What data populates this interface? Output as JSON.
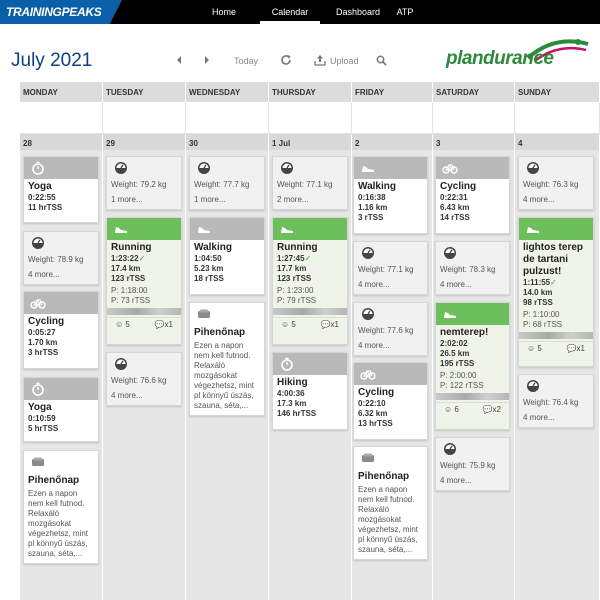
{
  "topbar": {
    "logo": "TRAININGPEAKS",
    "nav": [
      {
        "label": "Home",
        "active": false
      },
      {
        "label": "Calendar",
        "active": true
      },
      {
        "label": "Dashboard",
        "active": false
      },
      {
        "label": "ATP",
        "active": false
      }
    ]
  },
  "toolbar": {
    "month": "July 2021",
    "today": "Today",
    "upload": "Upload",
    "brand": "plandurance"
  },
  "days": [
    "MONDAY",
    "TUESDAY",
    "WEDNESDAY",
    "THURSDAY",
    "FRIDAY",
    "SATURDAY",
    "SUNDAY"
  ],
  "dates": [
    "28",
    "29",
    "30",
    "1 Jul",
    "2",
    "3",
    "4"
  ],
  "cards": {
    "mon_yoga1": {
      "title": "Yoga",
      "duration": "0:22:55",
      "metric": "11 hrTSS"
    },
    "mon_weight": {
      "weight": "Weight: 78.9 kg",
      "more": "4 more..."
    },
    "mon_cycling": {
      "title": "Cycling",
      "duration": "0:05:27",
      "distance": "1.70 km",
      "metric": "3 hrTSS"
    },
    "mon_yoga2": {
      "title": "Yoga",
      "duration": "0:10:59",
      "metric": "5 hrTSS"
    },
    "mon_rest": {
      "title": "Pihenőnap",
      "desc": "Ezen a napon nem kell futnod. Relaxáló mozgásokat végezhetsz, mint pl könnyű úszás, szauna, séta,..."
    },
    "tue_weight1": {
      "weight": "Weight: 79.2 kg",
      "more": "1 more..."
    },
    "tue_running": {
      "title": "Running",
      "duration": "1:23:22",
      "distance": "17.4 km",
      "metric": "123 rTSS",
      "planned_dur": "P: 1:18:00",
      "planned_tss": "P: 73 rTSS",
      "comments": "5",
      "likes": "x1"
    },
    "tue_weight2": {
      "weight": "Weight: 76.6 kg",
      "more": "4 more..."
    },
    "wed_weight": {
      "weight": "Weight: 77.7 kg",
      "more": "1 more..."
    },
    "wed_walking": {
      "title": "Walking",
      "duration": "1:04:50",
      "distance": "5.23 km",
      "metric": "18 rTSS"
    },
    "wed_rest": {
      "title": "Pihenőnap",
      "desc": "Ezen a napon nem kell futnod. Relaxáló mozgásokat végezhetsz, mint pl könnyű úszás, szauna, séta,..."
    },
    "thu_weight": {
      "weight": "Weight: 77.1 kg",
      "more": "2 more..."
    },
    "thu_running": {
      "title": "Running",
      "duration": "1:27:45",
      "distance": "17.7 km",
      "metric": "123 rTSS",
      "planned_dur": "P: 1:23:00",
      "planned_tss": "P: 79 rTSS",
      "comments": "5",
      "likes": "x1"
    },
    "thu_hiking": {
      "title": "Hiking",
      "duration": "4:00:36",
      "distance": "17.3 km",
      "metric": "146 hrTSS"
    },
    "fri_walking": {
      "title": "Walking",
      "duration": "0:16:38",
      "distance": "1.16 km",
      "metric": "3 rTSS"
    },
    "fri_weight1": {
      "weight": "Weight: 77.1 kg",
      "more": "4 more..."
    },
    "fri_weight2": {
      "weight": "Weight: 77.6 kg",
      "more": "4 more..."
    },
    "fri_cycling": {
      "title": "Cycling",
      "duration": "0:22:10",
      "distance": "6.32 km",
      "metric": "13 hrTSS"
    },
    "fri_rest": {
      "title": "Pihenőnap",
      "desc": "Ezen a napon nem kell futnod. Relaxáló mozgásokat végezhetsz, mint pl könnyű úszás, szauna, séta,..."
    },
    "sat_cycling": {
      "title": "Cycling",
      "duration": "0:22:31",
      "distance": "6.43 km",
      "metric": "14 rTSS"
    },
    "sat_weight1": {
      "weight": "Weight: 78.3 kg",
      "more": "4 more..."
    },
    "sat_run": {
      "title": "nemterep!",
      "duration": "2:02:02",
      "distance": "26.5 km",
      "metric": "195 rTSS",
      "planned_dur": "P: 2:00:00",
      "planned_tss": "P: 122 rTSS",
      "comments": "6",
      "likes": "x2"
    },
    "sat_weight2": {
      "weight": "Weight: 75.9 kg",
      "more": "4 more..."
    },
    "sun_weight1": {
      "weight": "Weight: 76.3 kg",
      "more": "4 more..."
    },
    "sun_run": {
      "title": "lightos terep de tartani pulzust!",
      "duration": "1:11:55",
      "distance": "14.0 km",
      "metric": "98 rTSS",
      "planned_dur": "P: 1:10:00",
      "planned_tss": "P: 68 rTSS",
      "comments": "5",
      "likes": "x1"
    },
    "sun_weight2": {
      "weight": "Weight: 76.4 kg",
      "more": "4 more..."
    }
  }
}
